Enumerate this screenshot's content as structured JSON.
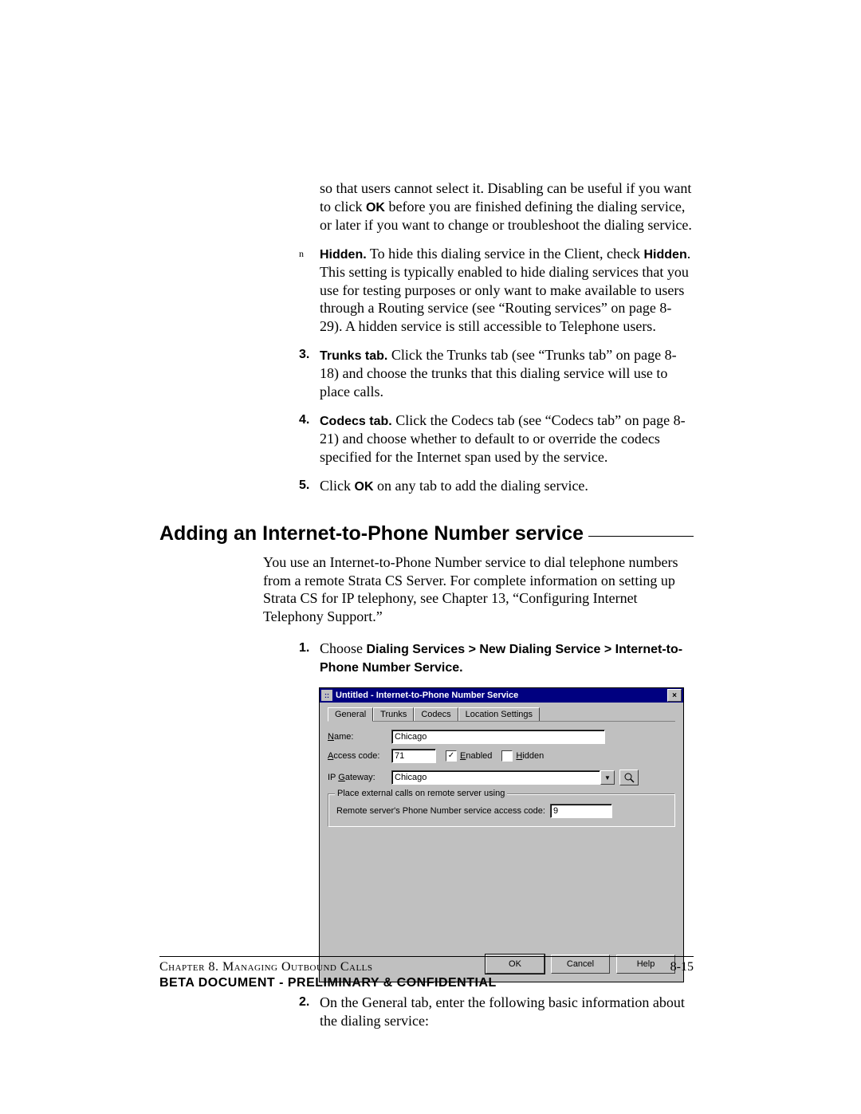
{
  "top": {
    "disable_tail": "so that users cannot select it. Disabling can be useful if you want to click ",
    "ok": "OK",
    "disable_tail2": " before you are finished defining the dialing service, or later if you want to change or troubleshoot the dialing service.",
    "hidden_label": "Hidden.",
    "hidden_body": " To hide this dialing service in the Client, check ",
    "hidden_bold2": "Hidden",
    "hidden_body2": ". This setting is typically enabled to hide dialing services that you use for testing purposes or only want to make available to users through a Routing service (see “Routing services” on page 8-29). A hidden service is still accessible to Telephone users.",
    "step3_num": "3.",
    "step3_bold": "Trunks tab.",
    "step3_body": " Click the Trunks tab (see “Trunks tab” on page 8-18) and choose the trunks that this dialing service will use to place calls.",
    "step4_num": "4.",
    "step4_bold": "Codecs tab.",
    "step4_body": " Click the Codecs tab (see “Codecs tab” on page 8-21) and choose whether to default to or override the codecs specified for the Internet span used by the service.",
    "step5_num": "5.",
    "step5_a": "Click ",
    "step5_ok": "OK",
    "step5_b": " on any tab to add the dialing service."
  },
  "section": {
    "heading": "Adding an Internet-to-Phone Number service",
    "intro": "You use an Internet-to-Phone Number service to dial telephone numbers from a remote Strata CS Server. For complete information on setting up Strata CS for IP telephony, see Chapter 13, “Configuring Internet Telephony Support.”",
    "step1_num": "1.",
    "step1_a": "Choose ",
    "step1_bold": "Dialing Services > New Dialing Service > Internet-to-Phone Number Service.",
    "step2_num": "2.",
    "step2_body": "On the General tab, enter the following basic information about the dialing service:"
  },
  "dialog": {
    "title": "Untitled - Internet-to-Phone Number Service",
    "tabs": [
      "General",
      "Trunks",
      "Codecs",
      "Location Settings"
    ],
    "name_label": "Name:",
    "name_value": "Chicago",
    "access_label": "Access code:",
    "access_value": "71",
    "enabled_label": "Enabled",
    "hidden_label": "Hidden",
    "gateway_label": "IP Gateway:",
    "gateway_value": "Chicago",
    "group_legend": "Place external calls on remote server using",
    "remote_label": "Remote server's Phone Number service access code:",
    "remote_value": "9",
    "ok": "OK",
    "cancel": "Cancel",
    "help": "Help"
  },
  "footer": {
    "chapter": "Chapter 8. Managing Outbound Calls",
    "pagenum": "8-15",
    "confidential": "BETA DOCUMENT - PRELIMINARY & CONFIDENTIAL"
  }
}
